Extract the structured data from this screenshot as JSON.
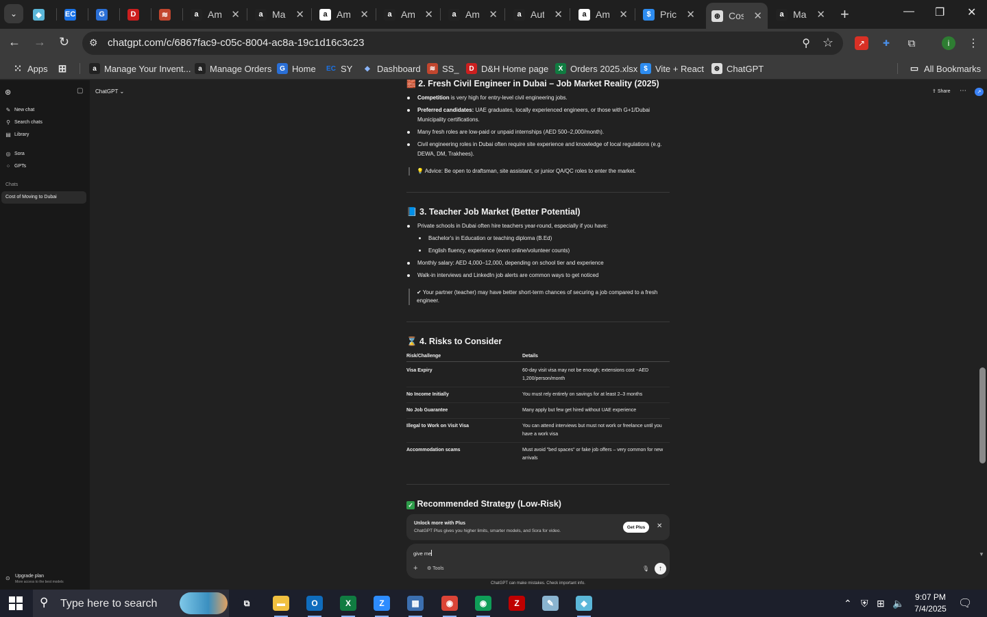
{
  "browser": {
    "tabs": [
      {
        "title": "",
        "icon": "diamond-icon",
        "color": "#5bb7d9",
        "glyph": "◆",
        "closable": false
      },
      {
        "title": "",
        "icon": "ec-icon",
        "color": "#1a73e8",
        "glyph": "EC",
        "closable": false
      },
      {
        "title": "",
        "icon": "g-icon",
        "color": "#2a6fd6",
        "glyph": "G",
        "closable": false
      },
      {
        "title": "",
        "icon": "dh-icon",
        "color": "#cc1f1f",
        "glyph": "D",
        "closable": false
      },
      {
        "title": "",
        "icon": "stack-icon",
        "color": "#c2462e",
        "glyph": "≋",
        "closable": false
      },
      {
        "title": "Ama",
        "icon": "amazon-icon",
        "color": "#222222",
        "glyph": "a",
        "closable": true
      },
      {
        "title": "Man",
        "icon": "amazon-icon",
        "color": "#222222",
        "glyph": "a",
        "closable": true
      },
      {
        "title": "Ama",
        "icon": "amazon-icon",
        "color": "#ffffff",
        "glyph": "a",
        "closable": true
      },
      {
        "title": "Ama",
        "icon": "amazon-icon",
        "color": "#222222",
        "glyph": "a",
        "closable": true
      },
      {
        "title": "Ama",
        "icon": "amazon-icon",
        "color": "#222222",
        "glyph": "a",
        "closable": true
      },
      {
        "title": "Autc",
        "icon": "amazon-icon",
        "color": "#222222",
        "glyph": "a",
        "closable": true
      },
      {
        "title": "Ama",
        "icon": "amazon-icon",
        "color": "#ffffff",
        "glyph": "a",
        "closable": true
      },
      {
        "title": "Prici",
        "icon": "dollar-icon",
        "color": "#2d8cf0",
        "glyph": "$",
        "closable": true
      },
      {
        "title": "Cost",
        "icon": "chatgpt-icon",
        "color": "#dddddd",
        "glyph": "⊛",
        "closable": true,
        "active": true
      },
      {
        "title": "Man",
        "icon": "amazon-icon",
        "color": "#222222",
        "glyph": "a",
        "closable": true
      }
    ],
    "url": "chatgpt.com/c/6867fac9-c05c-8004-ac8a-19c1d16c3c23",
    "bookmarks": [
      {
        "label": "Apps",
        "icon": "apps-grid-icon"
      },
      {
        "label": "",
        "icon": "tab-groups-icon"
      },
      {
        "label": "Manage Your Invent...",
        "icon": "amazon-icon"
      },
      {
        "label": "Manage Orders",
        "icon": "amazon-icon"
      },
      {
        "label": "Home",
        "icon": "g-icon"
      },
      {
        "label": "SY",
        "icon": "ec-icon"
      },
      {
        "label": "Dashboard",
        "icon": "dashboard-icon"
      },
      {
        "label": "SS_",
        "icon": "stack-icon"
      },
      {
        "label": "D&H Home page",
        "icon": "dh-icon"
      },
      {
        "label": "Orders 2025.xlsx",
        "icon": "excel-icon"
      },
      {
        "label": "Vite + React",
        "icon": "dollar-icon"
      },
      {
        "label": "ChatGPT",
        "icon": "chatgpt-icon"
      }
    ],
    "all_bookmarks": "All Bookmarks",
    "profile_initial": "i"
  },
  "sidebar": {
    "items": [
      {
        "label": "New chat",
        "icon": "new-chat-icon"
      },
      {
        "label": "Search chats",
        "icon": "search-icon"
      },
      {
        "label": "Library",
        "icon": "library-icon"
      },
      {
        "label": "Sora",
        "icon": "sora-icon"
      },
      {
        "label": "GPTs",
        "icon": "gpts-icon"
      }
    ],
    "section_title": "Chats",
    "active_chat": "Cost of Moving to Dubai",
    "upgrade_title": "Upgrade plan",
    "upgrade_sub": "More access to the best models"
  },
  "header": {
    "model": "ChatGPT",
    "share": "Share"
  },
  "message": {
    "s2_title": "2. Fresh Civil Engineer in Dubai – Job Market Reality (2025)",
    "s2_emoji": "🧱",
    "s2_bullets": [
      {
        "b": "Competition",
        "t": " is very high for entry-level civil engineering jobs."
      },
      {
        "b": "Preferred candidates:",
        "t": " UAE graduates, locally experienced engineers, or those with G+1/Dubai Municipality certifications."
      },
      {
        "b": "",
        "t": "Many fresh roles are low-paid or unpaid internships (AED 500–2,000/month)."
      },
      {
        "b": "",
        "t": "Civil engineering roles in Dubai often require site experience and knowledge of local regulations (e.g. DEWA, DM, Trakhees)."
      }
    ],
    "s2_advice": "💡 Advice: Be open to draftsman, site assistant, or junior QA/QC roles to enter the market.",
    "s3_title": "📘 3. Teacher Job Market (Better Potential)",
    "s3_bullets": [
      "Private schools in Dubai often hire teachers year-round, especially if you have:",
      "Monthly salary: AED 4,000–12,000, depending on school tier and experience",
      "Walk-in interviews and LinkedIn job alerts are common ways to get noticed"
    ],
    "s3_sub": [
      "Bachelor's in Education or teaching diploma (B.Ed)",
      "English fluency, experience (even online/volunteer counts)"
    ],
    "s3_note": "✔ Your partner (teacher) may have better short-term chances of securing a job compared to a fresh engineer.",
    "s4_title": "⌛ 4. Risks to Consider",
    "s4_table": {
      "headers": [
        "Risk/Challenge",
        "Details"
      ],
      "rows": [
        [
          "Visa Expiry",
          "60-day visit visa may not be enough; extensions cost ~AED 1,200/person/month"
        ],
        [
          "No Income Initially",
          "You must rely entirely on savings for at least 2–3 months"
        ],
        [
          "No Job Guarantee",
          "Many apply but few get hired without UAE experience"
        ],
        [
          "Illegal to Work on Visit Visa",
          "You can attend interviews but must not work or freelance until you have a work visa"
        ],
        [
          "Accommodation scams",
          "Must avoid \"bed spaces\" or fake job offers – very common for new arrivals"
        ]
      ]
    },
    "s5_title": "Recommended Strategy (Low-Risk)"
  },
  "plus_banner": {
    "title": "Unlock more with Plus",
    "subtitle": "ChatGPT Plus gives you higher limits, smarter models, and Sora for video.",
    "button": "Get Plus"
  },
  "composer": {
    "value": "give me",
    "tools": "Tools"
  },
  "disclaimer": "ChatGPT can make mistakes. Check important info.",
  "taskbar": {
    "search_placeholder": "Type here to search",
    "time": "9:07 PM",
    "date": "7/4/2025",
    "apps": [
      {
        "name": "task-view-icon",
        "glyph": "⧉",
        "color": "#1c1f2b"
      },
      {
        "name": "file-explorer-icon",
        "glyph": "▬",
        "color": "#f0c040"
      },
      {
        "name": "outlook-icon",
        "glyph": "O",
        "color": "#0f6cbd"
      },
      {
        "name": "excel-icon",
        "glyph": "X",
        "color": "#107c41"
      },
      {
        "name": "zoom-icon",
        "glyph": "Z",
        "color": "#2d8cff"
      },
      {
        "name": "calculator-icon",
        "glyph": "▦",
        "color": "#3c6fb0"
      },
      {
        "name": "chrome-icon",
        "glyph": "◉",
        "color": "#db4437"
      },
      {
        "name": "chrome-icon",
        "glyph": "◉",
        "color": "#0f9d58"
      },
      {
        "name": "filezilla-icon",
        "glyph": "Z",
        "color": "#bf0000"
      },
      {
        "name": "notepad-icon",
        "glyph": "✎",
        "color": "#8ab4d0"
      },
      {
        "name": "diamond-icon",
        "glyph": "◆",
        "color": "#5bb7d9"
      }
    ]
  }
}
